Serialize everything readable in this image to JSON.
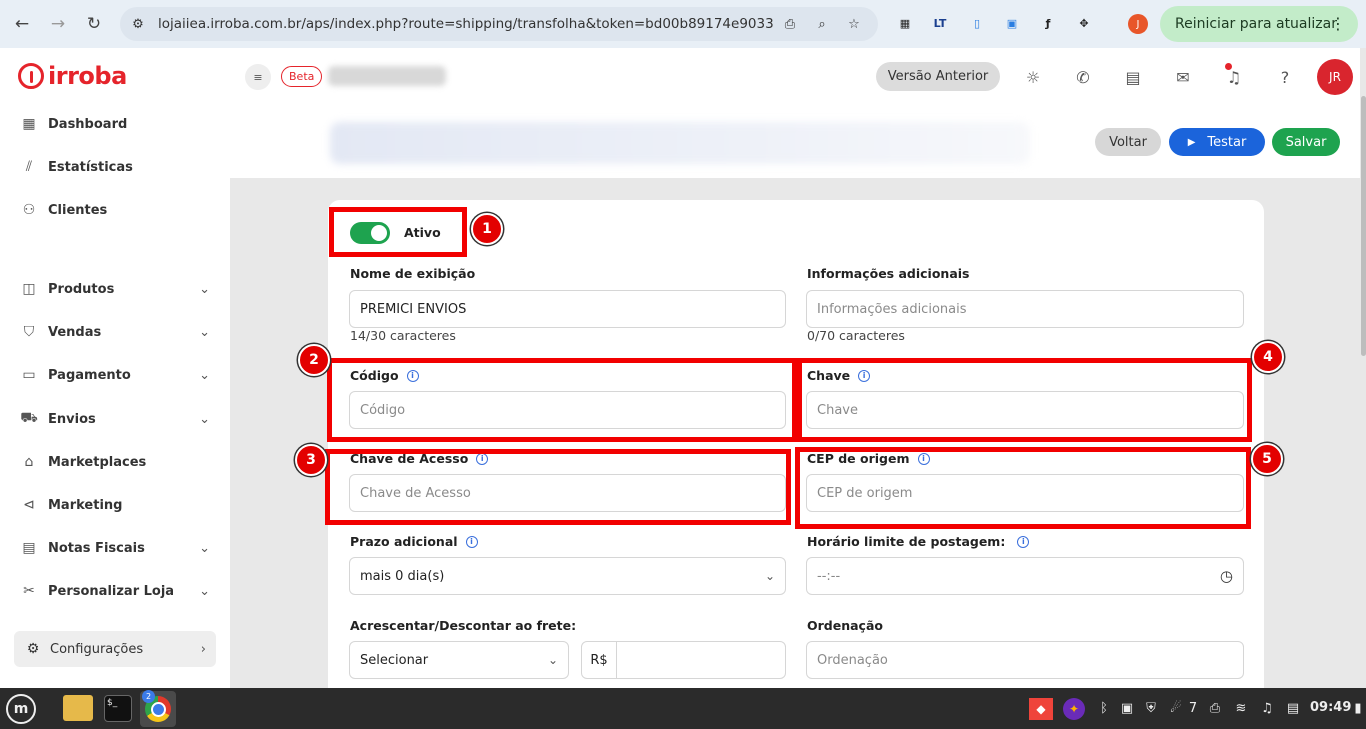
{
  "browser": {
    "url": "lojaiiea.irroba.com.br/aps/index.php?route=shipping/transfolha&token=bd00b89174e9033",
    "profile_initial": "J",
    "restart_label": "Reiniciar para atualizar"
  },
  "app": {
    "logo_text": "irroba",
    "beta_badge": "Beta",
    "previous_version_button": "Versão Anterior",
    "user_initials": "JR"
  },
  "sidebar": {
    "items": [
      {
        "label": "Dashboard",
        "icon": "dashboard-icon"
      },
      {
        "label": "Estatísticas",
        "icon": "chart-icon"
      },
      {
        "label": "Clientes",
        "icon": "users-icon"
      },
      {
        "label": "Produtos",
        "icon": "box-icon"
      },
      {
        "label": "Vendas",
        "icon": "bag-icon"
      },
      {
        "label": "Pagamento",
        "icon": "card-icon"
      },
      {
        "label": "Envios",
        "icon": "truck-icon"
      },
      {
        "label": "Marketplaces",
        "icon": "store-icon"
      },
      {
        "label": "Marketing",
        "icon": "megaphone-icon"
      },
      {
        "label": "Notas Fiscais",
        "icon": "document-icon"
      },
      {
        "label": "Personalizar Loja",
        "icon": "tools-icon"
      }
    ],
    "config_label": "Configurações"
  },
  "actions": {
    "back": "Voltar",
    "test": "Testar",
    "save": "Salvar"
  },
  "form": {
    "active_label": "Ativo",
    "active_on": true,
    "display_name": {
      "label": "Nome de exibição",
      "value": "PREMICI ENVIOS",
      "counter": "14/30 caracteres"
    },
    "additional_info": {
      "label": "Informações adicionais",
      "placeholder": "Informações adicionais",
      "counter": "0/70 caracteres"
    },
    "code": {
      "label": "Código",
      "placeholder": "Código"
    },
    "key": {
      "label": "Chave",
      "placeholder": "Chave"
    },
    "access_key": {
      "label": "Chave de Acesso",
      "placeholder": "Chave de Acesso"
    },
    "origin_zip": {
      "label": "CEP de origem",
      "placeholder": "CEP de origem"
    },
    "extra_days": {
      "label": "Prazo adicional",
      "value": "mais 0 dia(s)"
    },
    "posting_time": {
      "label": "Horário limite de postagem:",
      "value": "--:--"
    },
    "freight_adjust": {
      "label": "Acrescentar/Descontar ao frete:",
      "value": "Selecionar",
      "currency": "R$"
    },
    "ordering": {
      "label": "Ordenação",
      "placeholder": "Ordenação"
    }
  },
  "annotations": [
    "1",
    "2",
    "3",
    "4",
    "5"
  ],
  "taskbar": {
    "chrome_badge": "2",
    "terminal_glyph": "$_",
    "notification_count": "7",
    "time": "09:49"
  },
  "colors": {
    "brand_red": "#e5242b",
    "primary_blue": "#1b64db",
    "success_green": "#1ea34f",
    "annotation_red": "#f20000"
  }
}
